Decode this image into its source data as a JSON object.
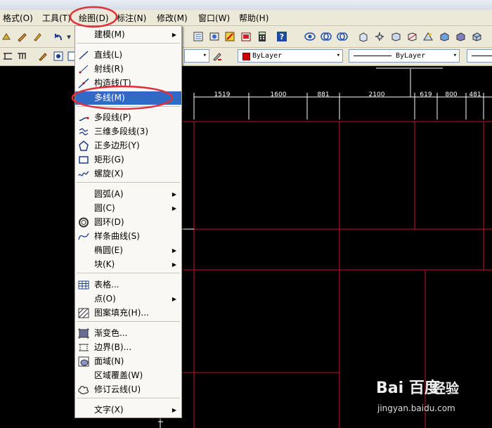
{
  "menubar": {
    "items": [
      {
        "label": "格式(O)"
      },
      {
        "label": "工具(T)"
      },
      {
        "label": "绘图(D)"
      },
      {
        "label": "标注(N)"
      },
      {
        "label": "修改(M)"
      },
      {
        "label": "窗口(W)"
      },
      {
        "label": "帮助(H)"
      }
    ]
  },
  "toolbar": {
    "layer_color_select": "ByLayer",
    "linetype_select": "ByLayer"
  },
  "draw_menu": {
    "items": [
      {
        "label": "建模(M)",
        "submenu": true,
        "icon": "none"
      },
      {
        "label": "直线(L)",
        "icon": "line-icon"
      },
      {
        "label": "射线(R)",
        "icon": "ray-icon"
      },
      {
        "label": "构造线(T)",
        "icon": "construction-line-icon"
      },
      {
        "label": "多线(M)",
        "icon": "none",
        "highlighted": true
      },
      {
        "label": "多段线(P)",
        "icon": "polyline-icon"
      },
      {
        "label": "三维多段线(3)",
        "icon": "3d-polyline-icon"
      },
      {
        "label": "正多边形(Y)",
        "icon": "polygon-icon"
      },
      {
        "label": "矩形(G)",
        "icon": "rectangle-icon"
      },
      {
        "label": "螺旋(X)",
        "icon": "helix-icon"
      },
      {
        "label": "圆弧(A)",
        "submenu": true,
        "icon": "none"
      },
      {
        "label": "圆(C)",
        "submenu": true,
        "icon": "none"
      },
      {
        "label": "圆环(D)",
        "icon": "donut-icon"
      },
      {
        "label": "样条曲线(S)",
        "icon": "spline-icon"
      },
      {
        "label": "椭圆(E)",
        "submenu": true,
        "icon": "none"
      },
      {
        "label": "块(K)",
        "submenu": true,
        "icon": "none"
      },
      {
        "label": "表格...",
        "icon": "table-icon"
      },
      {
        "label": "点(O)",
        "submenu": true,
        "icon": "none"
      },
      {
        "label": "图案填充(H)...",
        "icon": "hatch-icon"
      },
      {
        "label": "渐变色...",
        "icon": "gradient-icon"
      },
      {
        "label": "边界(B)...",
        "icon": "boundary-icon"
      },
      {
        "label": "面域(N)",
        "icon": "region-icon"
      },
      {
        "label": "区域覆盖(W)",
        "icon": "none"
      },
      {
        "label": "修订云线(U)",
        "icon": "revcloud-icon"
      },
      {
        "label": "文字(X)",
        "submenu": true,
        "icon": "none"
      }
    ]
  },
  "drawing": {
    "dimensions": [
      "1519",
      "1600",
      "881",
      "2100",
      "619",
      "800",
      "481"
    ]
  },
  "watermark": {
    "logo": "Bai 百度",
    "site": "经验",
    "url": "jingyan.baidu.com"
  },
  "colors": {
    "menu_highlight": "#316ac5",
    "annotation_circle": "#e0303a",
    "drawing_lines": "#c8102e",
    "dimension_lines": "#ffffff",
    "canvas_bg": "#000000"
  }
}
